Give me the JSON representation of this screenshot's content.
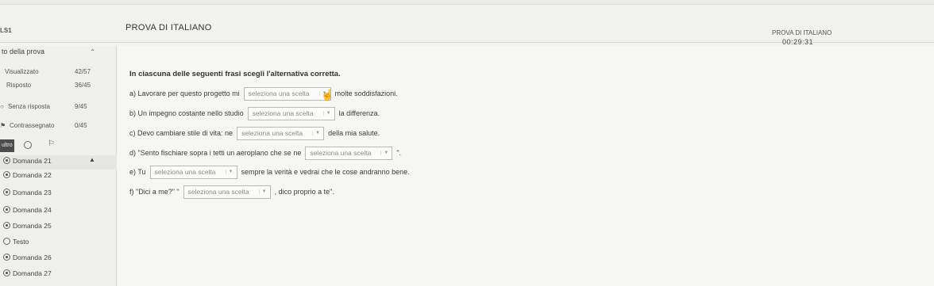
{
  "header": {
    "brand": "LS1",
    "title": "PROVA DI ITALIANO",
    "right_title": "PROVA DI ITALIANO",
    "timer": "00:29:31"
  },
  "sidebar": {
    "heading": "to della prova",
    "stats": [
      {
        "label": "Visualizzato",
        "value": "42/57"
      },
      {
        "label": "Risposto",
        "value": "36/45"
      },
      {
        "label": "Senza risposta",
        "value": "9/45"
      },
      {
        "label": "Contrassegnato",
        "value": "0/45"
      }
    ],
    "tool_label": "ultro",
    "questions": [
      {
        "label": "Domanda 21",
        "active": true
      },
      {
        "label": "Domanda 22"
      },
      {
        "label": "Domanda 23"
      },
      {
        "label": "Domanda 24"
      },
      {
        "label": "Domanda 25"
      },
      {
        "label": "Testo",
        "empty": true
      },
      {
        "label": "Domanda 26"
      },
      {
        "label": "Domanda 27"
      }
    ]
  },
  "main": {
    "instruction": "In ciascuna delle seguenti frasi scegli l'alternativa corretta.",
    "placeholder": "seleziona una scelta",
    "sentences": [
      {
        "before": "a) Lavorare per questo progetto mi",
        "after": "molte soddisfazioni."
      },
      {
        "before": "b) Un impegno costante nello studio",
        "after": "la differenza."
      },
      {
        "before": "c) Devo cambiare stile di vita: ne",
        "after": "della mia salute."
      },
      {
        "before": "d) \"Sento fischiare sopra i tetti un aeroplano che se ne",
        "after": "\"."
      },
      {
        "before": "e) Tu",
        "after": "sempre la verità e vedrai che le cose andranno bene."
      },
      {
        "before": "f) \"Dici a me?\" \"",
        "after": ", dico proprio a te\"."
      }
    ]
  }
}
